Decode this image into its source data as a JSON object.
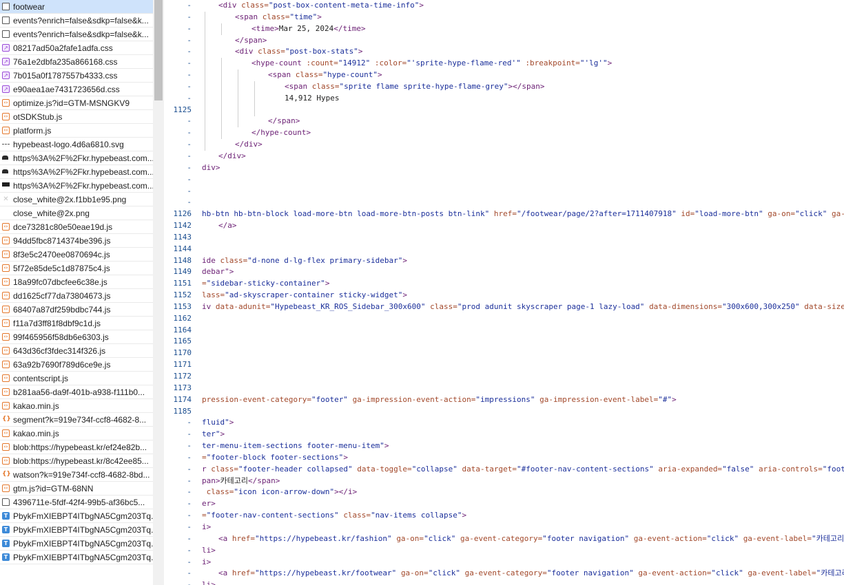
{
  "files": [
    {
      "name": "footwear",
      "icon": "document-icon",
      "selected": true
    },
    {
      "name": "events?enrich=false&sdkp=false&k...",
      "icon": "document-icon"
    },
    {
      "name": "events?enrich=false&sdkp=false&k...",
      "icon": "document-icon"
    },
    {
      "name": "08217ad50a2fafe1adfa.css",
      "icon": "stylesheet-icon"
    },
    {
      "name": "76a1e2dbfa235a866168.css",
      "icon": "stylesheet-icon"
    },
    {
      "name": "7b015a0f1787557b4333.css",
      "icon": "stylesheet-icon"
    },
    {
      "name": "e90aea1ae7431723656d.css",
      "icon": "stylesheet-icon"
    },
    {
      "name": "optimize.js?id=GTM-MSNGKV9",
      "icon": "script-icon"
    },
    {
      "name": "otSDKStub.js",
      "icon": "script-icon"
    },
    {
      "name": "platform.js",
      "icon": "script-icon"
    },
    {
      "name": "hypebeast-logo.4d6a6810.svg",
      "icon": "svg-icon"
    },
    {
      "name": "https%3A%2F%2Fkr.hypebeast.com...",
      "icon": "image-icon"
    },
    {
      "name": "https%3A%2F%2Fkr.hypebeast.com...",
      "icon": "image-icon"
    },
    {
      "name": "https%3A%2F%2Fkr.hypebeast.com...",
      "icon": "image-wide-icon"
    },
    {
      "name": "close_white@2x.f1bb1e95.png",
      "icon": "close-image-icon"
    },
    {
      "name": "close_white@2x.png",
      "icon": "blank-image-icon"
    },
    {
      "name": "dce73281c80e50eae19d.js",
      "icon": "script-icon"
    },
    {
      "name": "94dd5fbc8714374be396.js",
      "icon": "script-icon"
    },
    {
      "name": "8f3e5c2470ee0870694c.js",
      "icon": "script-icon"
    },
    {
      "name": "5f72e85de5c1d87875c4.js",
      "icon": "script-icon"
    },
    {
      "name": "18a99fc07dbcfee6c38e.js",
      "icon": "script-icon"
    },
    {
      "name": "dd1625cf77da73804673.js",
      "icon": "script-icon"
    },
    {
      "name": "68407a87df259bdbc744.js",
      "icon": "script-icon"
    },
    {
      "name": "f11a7d3ff81f8dbf9c1d.js",
      "icon": "script-icon"
    },
    {
      "name": "99f465956f58db6e6303.js",
      "icon": "script-icon"
    },
    {
      "name": "643d36cf3fdec314f326.js",
      "icon": "script-icon"
    },
    {
      "name": "63a92b7690f789d6ce9e.js",
      "icon": "script-icon"
    },
    {
      "name": "contentscript.js",
      "icon": "script-icon"
    },
    {
      "name": "b281aa56-da9f-401b-a938-f111b0...",
      "icon": "script-icon"
    },
    {
      "name": "kakao.min.js",
      "icon": "script-icon"
    },
    {
      "name": "segment?k=919e734f-ccf8-4682-8...",
      "icon": "json-icon"
    },
    {
      "name": "kakao.min.js",
      "icon": "script-icon"
    },
    {
      "name": "blob:https://hypebeast.kr/ef24e82b...",
      "icon": "script-icon"
    },
    {
      "name": "blob:https://hypebeast.kr/8c42ee85...",
      "icon": "script-icon"
    },
    {
      "name": "watson?k=919e734f-ccf8-4682-8bd...",
      "icon": "json-icon"
    },
    {
      "name": "gtm.js?id=GTM-68NN",
      "icon": "script-icon"
    },
    {
      "name": "4396711e-5fdf-42f4-99b5-af36bc5...",
      "icon": "file-icon"
    },
    {
      "name": "PbykFmXIEBPT4ITbgNA5Cgm203Tq...",
      "icon": "font-icon"
    },
    {
      "name": "PbykFmXIEBPT4ITbgNA5Cgm203Tq...",
      "icon": "font-icon"
    },
    {
      "name": "PbykFmXIEBPT4ITbgNA5Cgm203Tq...",
      "icon": "font-icon"
    },
    {
      "name": "PbykFmXIEBPT4ITbgNA5Cgm203Tq...",
      "icon": "font-icon"
    }
  ],
  "code_lines": [
    {
      "ln": "-",
      "indent": 1,
      "guides": [],
      "segs": [
        [
          "t",
          "<div "
        ],
        [
          "a",
          "class="
        ],
        [
          "v",
          "\"post-box-content-meta-time-info\""
        ],
        [
          "t",
          ">"
        ]
      ]
    },
    {
      "ln": "-",
      "indent": 2,
      "guides": [
        1
      ],
      "segs": [
        [
          "t",
          "<span "
        ],
        [
          "a",
          "class="
        ],
        [
          "v",
          "\"time\""
        ],
        [
          "t",
          ">"
        ]
      ]
    },
    {
      "ln": "-",
      "indent": 3,
      "guides": [
        1,
        2
      ],
      "segs": [
        [
          "t",
          "<time>"
        ],
        [
          "x",
          "Mar 25, 2024"
        ],
        [
          "t",
          "</time>"
        ]
      ]
    },
    {
      "ln": "-",
      "indent": 2,
      "guides": [
        1
      ],
      "segs": [
        [
          "t",
          "</span>"
        ]
      ]
    },
    {
      "ln": "-",
      "indent": 2,
      "guides": [
        1
      ],
      "segs": [
        [
          "t",
          "<div "
        ],
        [
          "a",
          "class="
        ],
        [
          "v",
          "\"post-box-stats\""
        ],
        [
          "t",
          ">"
        ]
      ]
    },
    {
      "ln": "-",
      "indent": 3,
      "guides": [
        1,
        2
      ],
      "segs": [
        [
          "t",
          "<hype-count "
        ],
        [
          "a",
          ":count="
        ],
        [
          "v",
          "\"14912\""
        ],
        [
          "x",
          " "
        ],
        [
          "a",
          ":color="
        ],
        [
          "v",
          "\"'sprite-hype-flame-red'\""
        ],
        [
          "x",
          " "
        ],
        [
          "a",
          ":breakpoint="
        ],
        [
          "v",
          "\"'lg'\""
        ],
        [
          "t",
          ">"
        ]
      ]
    },
    {
      "ln": "-",
      "indent": 4,
      "guides": [
        1,
        2,
        3
      ],
      "segs": [
        [
          "t",
          "<span "
        ],
        [
          "a",
          "class="
        ],
        [
          "v",
          "\"hype-count\""
        ],
        [
          "t",
          ">"
        ]
      ]
    },
    {
      "ln": "-",
      "indent": 5,
      "guides": [
        1,
        2,
        3,
        4
      ],
      "segs": [
        [
          "t",
          "<span "
        ],
        [
          "a",
          "class="
        ],
        [
          "v",
          "\"sprite flame sprite-hype-flame-grey\""
        ],
        [
          "t",
          "></span>"
        ]
      ]
    },
    {
      "ln": "-",
      "indent": 5,
      "guides": [
        1,
        2,
        3,
        4
      ],
      "segs": [
        [
          "x",
          "14,912 Hypes"
        ]
      ]
    },
    {
      "ln": "1125",
      "indent": 0,
      "guides": [
        1,
        2,
        3,
        4
      ],
      "segs": []
    },
    {
      "ln": "-",
      "indent": 4,
      "guides": [
        1,
        2,
        3
      ],
      "segs": [
        [
          "t",
          "</span>"
        ]
      ]
    },
    {
      "ln": "-",
      "indent": 3,
      "guides": [
        1,
        2
      ],
      "segs": [
        [
          "t",
          "</hype-count>"
        ]
      ]
    },
    {
      "ln": "-",
      "indent": 2,
      "guides": [
        1
      ],
      "segs": [
        [
          "t",
          "</div>"
        ]
      ]
    },
    {
      "ln": "-",
      "indent": 1,
      "guides": [],
      "segs": [
        [
          "t",
          "</div>"
        ]
      ]
    },
    {
      "ln": "-",
      "indent": 0,
      "guides": [],
      "segs": [
        [
          "t",
          "div>"
        ]
      ]
    },
    {
      "ln": "-",
      "indent": 0,
      "guides": [],
      "segs": []
    },
    {
      "ln": "-",
      "indent": 0,
      "guides": [],
      "segs": []
    },
    {
      "ln": "-",
      "indent": 0,
      "guides": [],
      "segs": []
    },
    {
      "ln": "1126",
      "indent": 0,
      "guides": [],
      "segs": [
        [
          "v",
          "hb-btn hb-btn-block load-more-btn load-more-btn-posts btn-link\""
        ],
        [
          "x",
          " "
        ],
        [
          "a",
          "href="
        ],
        [
          "v",
          "\"/footwear/page/2?after=1711407918\""
        ],
        [
          "x",
          " "
        ],
        [
          "a",
          "id="
        ],
        [
          "v",
          "\"load-more-btn\""
        ],
        [
          "x",
          " "
        ],
        [
          "a",
          "ga-on="
        ],
        [
          "v",
          "\"click\""
        ],
        [
          "x",
          " "
        ],
        [
          "a",
          "ga-event-category="
        ]
      ]
    },
    {
      "ln": "1142",
      "indent": 1,
      "guides": [],
      "segs": [
        [
          "t",
          "</a>"
        ]
      ]
    },
    {
      "ln": "1143",
      "indent": 0,
      "guides": [],
      "segs": []
    },
    {
      "ln": "1144",
      "indent": 0,
      "guides": [],
      "segs": []
    },
    {
      "ln": "1148",
      "indent": 0,
      "guides": [],
      "segs": [
        [
          "t",
          "ide "
        ],
        [
          "a",
          "class="
        ],
        [
          "v",
          "\"d-none d-lg-flex primary-sidebar\""
        ],
        [
          "t",
          ">"
        ]
      ]
    },
    {
      "ln": "1149",
      "indent": 0,
      "guides": [],
      "segs": [
        [
          "t",
          "debar"
        ],
        [
          "t",
          "\">"
        ]
      ]
    },
    {
      "ln": "1151",
      "indent": 0,
      "guides": [],
      "segs": [
        [
          "a",
          "="
        ],
        [
          "v",
          "\"sidebar-sticky-container\""
        ],
        [
          "t",
          ">"
        ]
      ]
    },
    {
      "ln": "1152",
      "indent": 0,
      "guides": [],
      "segs": [
        [
          "a",
          "lass="
        ],
        [
          "v",
          "\"ad-skyscraper-container sticky-widget\""
        ],
        [
          "t",
          ">"
        ]
      ]
    },
    {
      "ln": "1153",
      "indent": 0,
      "guides": [],
      "segs": [
        [
          "t",
          "iv "
        ],
        [
          "a",
          "data-adunit="
        ],
        [
          "v",
          "\"Hypebeast_KR_ROS_Sidebar_300x600\""
        ],
        [
          "x",
          " "
        ],
        [
          "a",
          "class="
        ],
        [
          "v",
          "\"prod adunit skyscraper page-1 lazy-load\""
        ],
        [
          "x",
          " "
        ],
        [
          "a",
          "data-dimensions="
        ],
        [
          "v",
          "\"300x600,300x250\""
        ],
        [
          "x",
          " "
        ],
        [
          "a",
          "data-size-mapping="
        ],
        [
          "v",
          "\"\""
        ],
        [
          "x",
          " "
        ],
        [
          "a",
          "da"
        ]
      ]
    },
    {
      "ln": "1162",
      "indent": 0,
      "guides": [],
      "segs": []
    },
    {
      "ln": "1164",
      "indent": 0,
      "guides": [],
      "segs": []
    },
    {
      "ln": "1165",
      "indent": 0,
      "guides": [],
      "segs": []
    },
    {
      "ln": "1170",
      "indent": 0,
      "guides": [],
      "segs": []
    },
    {
      "ln": "1171",
      "indent": 0,
      "guides": [],
      "segs": []
    },
    {
      "ln": "1172",
      "indent": 0,
      "guides": [],
      "segs": []
    },
    {
      "ln": "1173",
      "indent": 0,
      "guides": [],
      "segs": []
    },
    {
      "ln": "1174",
      "indent": 0,
      "guides": [],
      "segs": [
        [
          "a",
          "pression-event-category="
        ],
        [
          "v",
          "\"footer\""
        ],
        [
          "x",
          " "
        ],
        [
          "a",
          "ga-impression-event-action="
        ],
        [
          "v",
          "\"impressions\""
        ],
        [
          "x",
          " "
        ],
        [
          "a",
          "ga-impression-event-label="
        ],
        [
          "v",
          "\"#\""
        ],
        [
          "t",
          ">"
        ]
      ]
    },
    {
      "ln": "1185",
      "indent": 0,
      "guides": [],
      "segs": []
    },
    {
      "ln": "-",
      "indent": 0,
      "guides": [],
      "segs": [
        [
          "v",
          "fluid\""
        ],
        [
          "t",
          ">"
        ]
      ]
    },
    {
      "ln": "-",
      "indent": 0,
      "guides": [],
      "segs": [
        [
          "v",
          "ter\""
        ],
        [
          "t",
          ">"
        ]
      ]
    },
    {
      "ln": "-",
      "indent": 0,
      "guides": [],
      "segs": [
        [
          "v",
          "ter-menu-item-sections footer-menu-item\""
        ],
        [
          "t",
          ">"
        ]
      ]
    },
    {
      "ln": "-",
      "indent": 0,
      "guides": [],
      "segs": [
        [
          "a",
          "="
        ],
        [
          "v",
          "\"footer-block footer-sections\""
        ],
        [
          "t",
          ">"
        ]
      ]
    },
    {
      "ln": "-",
      "indent": 0,
      "guides": [],
      "segs": [
        [
          "t",
          "r "
        ],
        [
          "a",
          "class="
        ],
        [
          "v",
          "\"footer-header collapsed\""
        ],
        [
          "x",
          " "
        ],
        [
          "a",
          "data-toggle="
        ],
        [
          "v",
          "\"collapse\""
        ],
        [
          "x",
          " "
        ],
        [
          "a",
          "data-target="
        ],
        [
          "v",
          "\"#footer-nav-content-sections\""
        ],
        [
          "x",
          " "
        ],
        [
          "a",
          "aria-expanded="
        ],
        [
          "v",
          "\"false\""
        ],
        [
          "x",
          " "
        ],
        [
          "a",
          "aria-controls="
        ],
        [
          "v",
          "\"footer-nav-content-"
        ]
      ]
    },
    {
      "ln": "-",
      "indent": 0,
      "guides": [],
      "segs": [
        [
          "t",
          "pan>"
        ],
        [
          "x",
          "카테고리"
        ],
        [
          "t",
          "</span>"
        ]
      ]
    },
    {
      "ln": "-",
      "indent": 0,
      "guides": [],
      "segs": [
        [
          "x",
          " "
        ],
        [
          "a",
          "class="
        ],
        [
          "v",
          "\"icon icon-arrow-down\""
        ],
        [
          "t",
          "></i>"
        ]
      ]
    },
    {
      "ln": "-",
      "indent": 0,
      "guides": [],
      "segs": [
        [
          "t",
          "er>"
        ]
      ]
    },
    {
      "ln": "-",
      "indent": 0,
      "guides": [],
      "segs": [
        [
          "a",
          "="
        ],
        [
          "v",
          "\"footer-nav-content-sections\""
        ],
        [
          "x",
          " "
        ],
        [
          "a",
          "class="
        ],
        [
          "v",
          "\"nav-items collapse\""
        ],
        [
          "t",
          ">"
        ]
      ]
    },
    {
      "ln": "-",
      "indent": 0,
      "guides": [],
      "segs": [
        [
          "t",
          "i>"
        ]
      ]
    },
    {
      "ln": "-",
      "indent": 1,
      "guides": [],
      "segs": [
        [
          "t",
          "<a "
        ],
        [
          "a",
          "href="
        ],
        [
          "v",
          "\"https://hypebeast.kr/fashion\""
        ],
        [
          "x",
          " "
        ],
        [
          "a",
          "ga-on="
        ],
        [
          "v",
          "\"click\""
        ],
        [
          "x",
          " "
        ],
        [
          "a",
          "ga-event-category="
        ],
        [
          "v",
          "\"footer navigation\""
        ],
        [
          "x",
          " "
        ],
        [
          "a",
          "ga-event-action="
        ],
        [
          "v",
          "\"click\""
        ],
        [
          "x",
          " "
        ],
        [
          "a",
          "ga-event-label="
        ],
        [
          "v",
          "\"카테고리 > 패션\""
        ],
        [
          "x",
          " "
        ],
        [
          "a",
          "data-"
        ]
      ]
    },
    {
      "ln": "-",
      "indent": 0,
      "guides": [],
      "segs": [
        [
          "t",
          "li>"
        ]
      ]
    },
    {
      "ln": "-",
      "indent": 0,
      "guides": [],
      "segs": [
        [
          "t",
          "i>"
        ]
      ]
    },
    {
      "ln": "-",
      "indent": 1,
      "guides": [],
      "segs": [
        [
          "t",
          "<a "
        ],
        [
          "a",
          "href="
        ],
        [
          "v",
          "\"https://hypebeast.kr/footwear\""
        ],
        [
          "x",
          " "
        ],
        [
          "a",
          "ga-on="
        ],
        [
          "v",
          "\"click\""
        ],
        [
          "x",
          " "
        ],
        [
          "a",
          "ga-event-category="
        ],
        [
          "v",
          "\"footer navigation\""
        ],
        [
          "x",
          " "
        ],
        [
          "a",
          "ga-event-action="
        ],
        [
          "v",
          "\"click\""
        ],
        [
          "x",
          " "
        ],
        [
          "a",
          "ga-event-label="
        ],
        [
          "v",
          "\"카테고리 > 신발\""
        ],
        [
          "x",
          " "
        ],
        [
          "a",
          "data-"
        ]
      ]
    },
    {
      "ln": "-",
      "indent": 0,
      "guides": [],
      "segs": [
        [
          "t",
          "li>"
        ]
      ]
    }
  ]
}
